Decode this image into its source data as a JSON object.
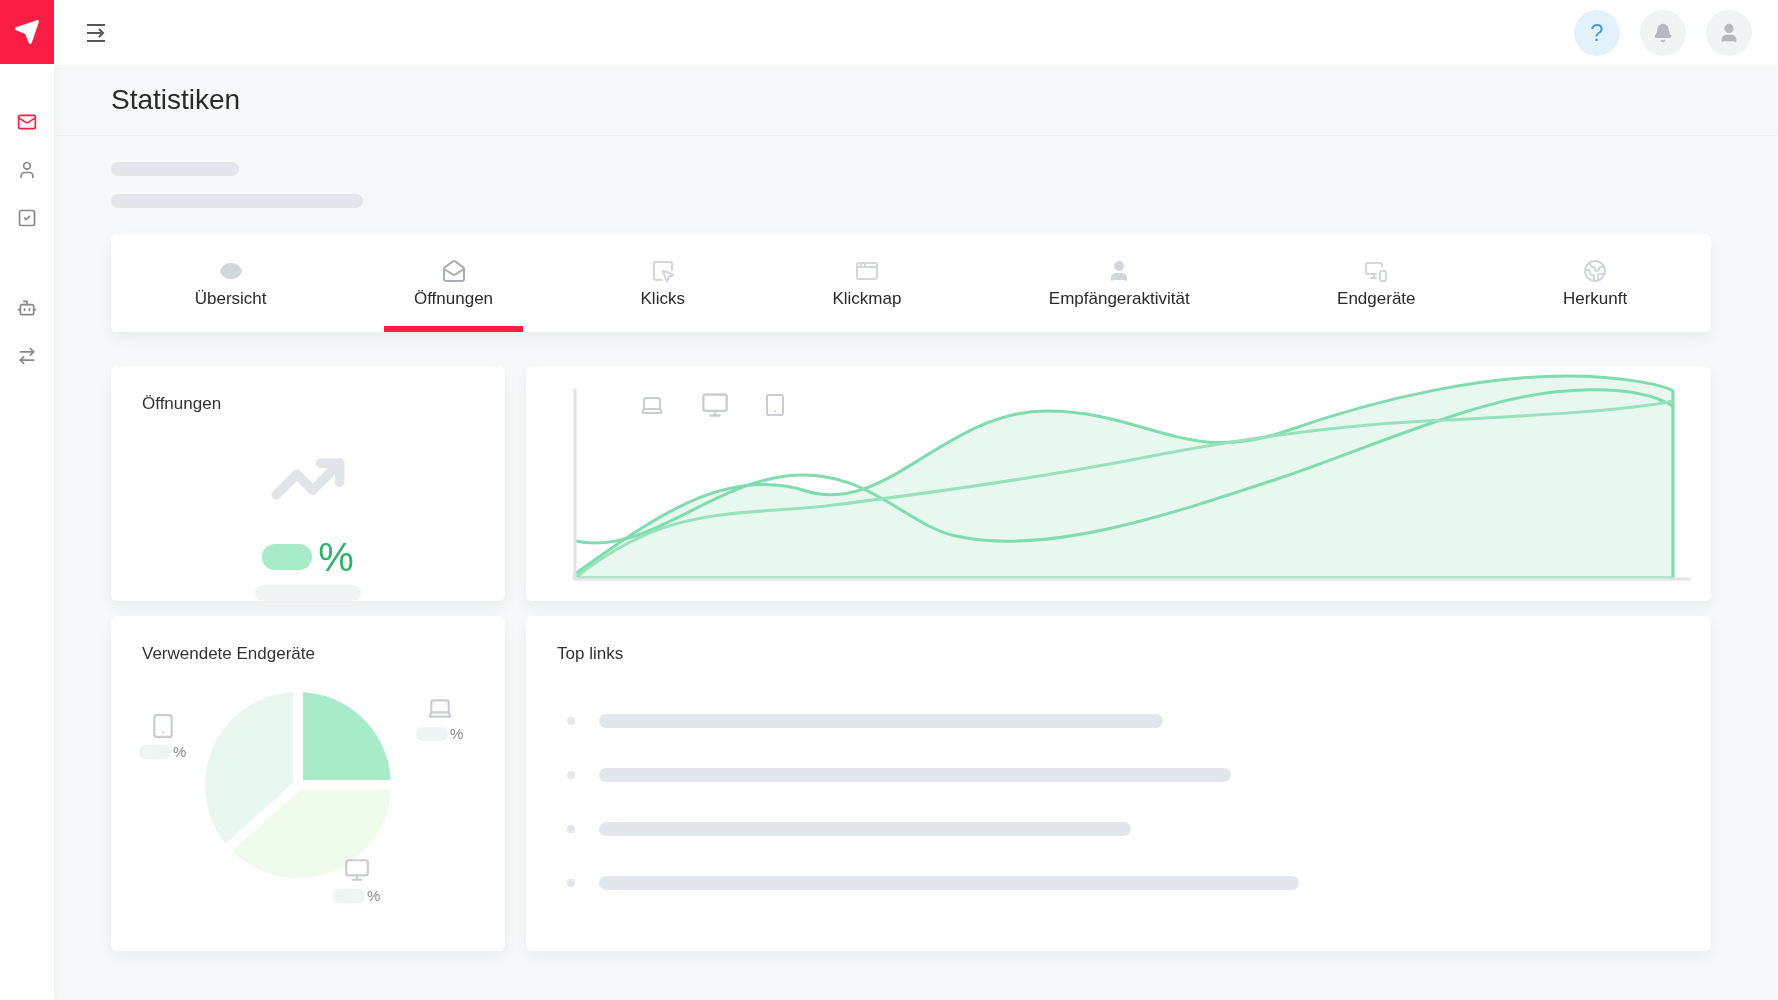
{
  "header": {
    "help": "?"
  },
  "page": {
    "title": "Statistiken"
  },
  "tabs": [
    {
      "label": "Übersicht",
      "selected": false
    },
    {
      "label": "Öffnungen",
      "selected": true
    },
    {
      "label": "Klicks",
      "selected": false
    },
    {
      "label": "Klickmap",
      "selected": false
    },
    {
      "label": "Empfängeraktivität",
      "selected": false
    },
    {
      "label": "Endgeräte",
      "selected": false
    },
    {
      "label": "Herkunft",
      "selected": false
    }
  ],
  "opens_card": {
    "title": "Öffnungen",
    "unit": "%"
  },
  "devices_card": {
    "title": "Verwendete Endgeräte",
    "labels": [
      {
        "kind": "tablet",
        "unit": "%"
      },
      {
        "kind": "laptop",
        "unit": "%"
      },
      {
        "kind": "desktop",
        "unit": "%"
      }
    ]
  },
  "links_card": {
    "title": "Top links"
  }
}
